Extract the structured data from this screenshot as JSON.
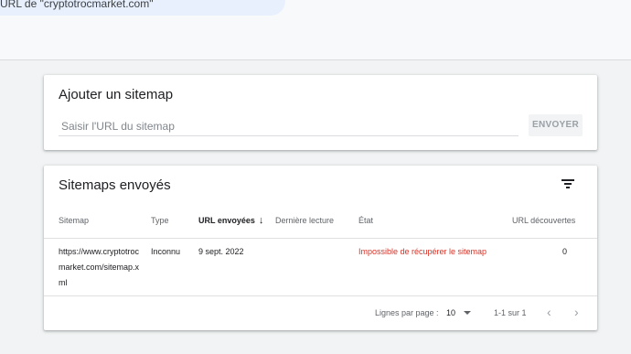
{
  "header": {
    "url_text": "URL de \"cryptotrocmarket.com\""
  },
  "add_sitemap": {
    "title": "Ajouter un sitemap",
    "input_placeholder": "Saisir l'URL du sitemap",
    "input_value": "",
    "send_label": "ENVOYER"
  },
  "sitemaps": {
    "title": "Sitemaps envoyés",
    "columns": [
      "Sitemap",
      "Type",
      "URL envoyées",
      "Dernière lecture",
      "État",
      "URL découvertes"
    ],
    "sort_icon": "arrow-down-icon",
    "rows": [
      {
        "sitemap": "https://www.cryptotrocmarket.com/sitemap.xml",
        "type": "Inconnu",
        "submitted": "9 sept. 2022",
        "last_read": "",
        "status": "Impossible de récupérer le sitemap",
        "discovered": "0"
      }
    ],
    "footer": {
      "rows_per_page_label": "Lignes par page :",
      "rows_per_page": "10",
      "range": "1-1 sur 1"
    }
  },
  "colors": {
    "error": "#d93025",
    "chip": "#e8f0fe"
  }
}
